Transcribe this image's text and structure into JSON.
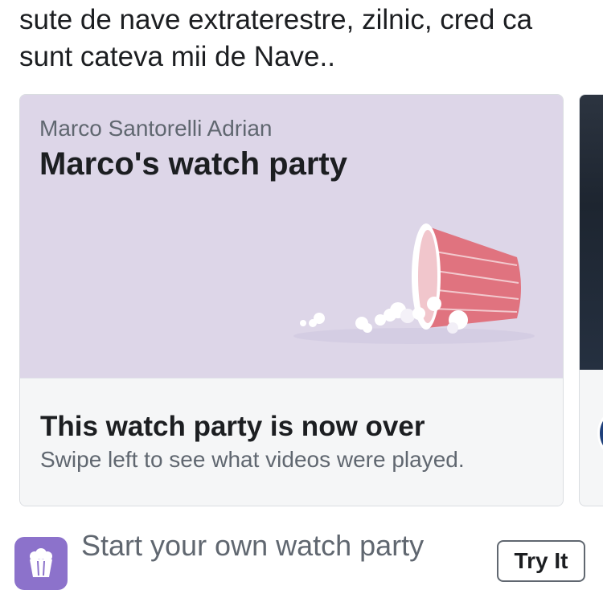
{
  "post": {
    "text": "sute de nave extraterestre, zilnic, cred ca sunt cateva mii de Nave.."
  },
  "watch_party_card": {
    "host_name": "Marco Santorelli Adrian",
    "title": "Marco's watch party",
    "hero_color": "#ddd6e8",
    "status_title": "This watch party is now over",
    "status_subtitle": "Swipe left to see what videos were played.",
    "illustration": "spilled-popcorn-cup-icon"
  },
  "start_row": {
    "label": "Start your own watch party",
    "icon": "popcorn-icon",
    "icon_color": "#8c72cb",
    "button_label": "Try It"
  }
}
